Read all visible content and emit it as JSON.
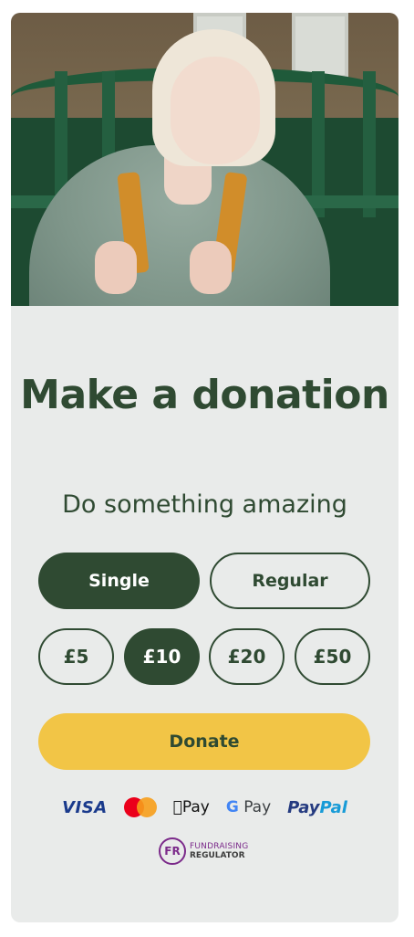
{
  "hero": {
    "image_alt_icon": "donor-photo"
  },
  "heading": {
    "title": "Make a donation",
    "subtitle": "Do something amazing"
  },
  "frequency": {
    "options": [
      "Single",
      "Regular"
    ],
    "selected": "Single"
  },
  "amounts": {
    "options": [
      "£5",
      "£10",
      "£20",
      "£50"
    ],
    "selected": "£10"
  },
  "donate_label": "Donate",
  "payment_methods": {
    "visa": "VISA",
    "applepay": "Pay",
    "googlepay": "Pay",
    "paypal_a": "Pay",
    "paypal_b": "Pal"
  },
  "regulator": {
    "badge": "FR",
    "line1": "FUNDRAISING",
    "line2": "REGULATOR"
  },
  "colors": {
    "primary": "#2f4a32",
    "accent": "#f2c546",
    "card_bg": "#e9ebea"
  }
}
